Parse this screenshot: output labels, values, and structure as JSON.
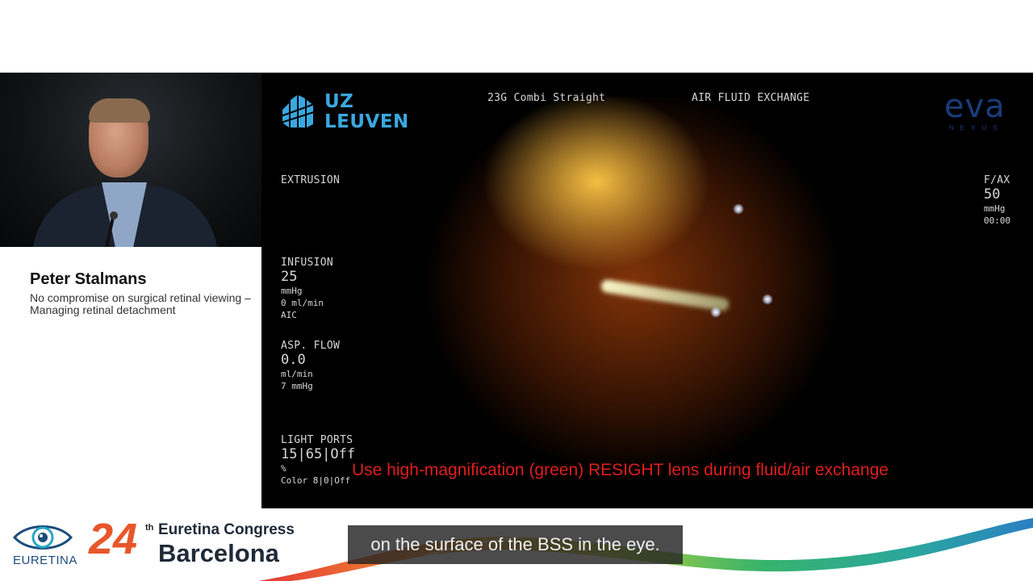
{
  "speaker": {
    "name": "Peter Stalmans",
    "talk_title": "No compromise on surgical retinal viewing – Managing retinal detachment"
  },
  "surgical_hud": {
    "hospital_logo": {
      "line1": "UZ",
      "line2": "LEUVEN",
      "color": "#3aa8e0"
    },
    "instrument": "23G Combi Straight",
    "mode": "AIR FLUID EXCHANGE",
    "device_logo": {
      "name": "eva",
      "sub": "NEXUS",
      "color": "#1a3d7a"
    },
    "extrusion_label": "EXTRUSION",
    "fax": {
      "label": "F/AX",
      "value": "50",
      "unit": "mmHg",
      "time": "00:00"
    },
    "infusion": {
      "label": "INFUSION",
      "value": "25",
      "unit": "mmHg",
      "flow": "0 ml/min",
      "mode": "AIC"
    },
    "asp_flow": {
      "label": "ASP. FLOW",
      "value": "0.0",
      "unit": "ml/min",
      "pressure": "7 mmHg"
    },
    "light_ports": {
      "label": "LIGHT PORTS",
      "value": "15|65|Off",
      "unit": "%",
      "color": "Color 8|0|Off"
    },
    "lens_note": "Use high-magnification (green) RESIGHT lens during fluid/air exchange",
    "lens_note_color": "#e01e1e"
  },
  "branding": {
    "org": "EURETINA",
    "congress_number": "24",
    "congress_number_suffix": "th",
    "congress_name": "Euretina Congress",
    "city": "Barcelona"
  },
  "subtitle": "on the surface of the BSS in the eye."
}
